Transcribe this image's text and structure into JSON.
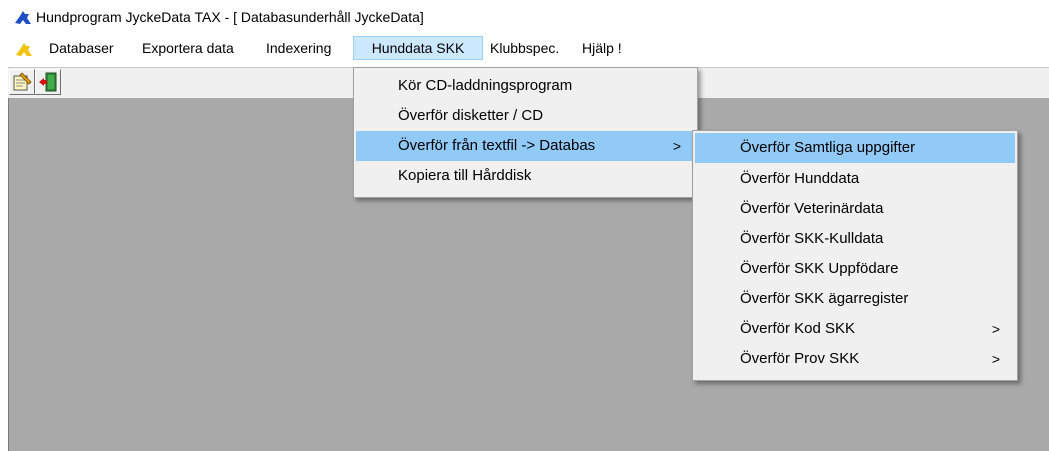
{
  "window": {
    "title": "Hundprogram JyckeData TAX - [  Databasunderhåll  JyckeData]",
    "icon": "blue-dog-icon"
  },
  "menubar": {
    "mdi_icon": "yellow-child-window-icon",
    "items": [
      {
        "label": "Databaser"
      },
      {
        "label": "Exportera data"
      },
      {
        "label": "Indexering"
      },
      {
        "label": "Hunddata SKK",
        "active": true
      },
      {
        "label": "Klubbspec."
      },
      {
        "label": "Hjälp !"
      }
    ]
  },
  "toolbar": {
    "buttons": [
      {
        "icon": "notepad-pen-icon"
      },
      {
        "icon": "exit-door-icon"
      }
    ]
  },
  "dropdown": {
    "items": [
      {
        "label": "Kör CD-laddningsprogram"
      },
      {
        "label": "Överför disketter / CD"
      },
      {
        "label": "Överför från textfil -> Databas",
        "submenu_arrow": ">",
        "highlighted": true
      },
      {
        "label": "Kopiera till Hårddisk"
      }
    ]
  },
  "submenu": {
    "items": [
      {
        "label": "Överför Samtliga uppgifter",
        "highlighted": true
      },
      {
        "label": "Överför Hunddata"
      },
      {
        "label": "Överför Veterinärdata"
      },
      {
        "label": "Överför SKK-Kulldata"
      },
      {
        "label": "Överför SKK Uppfödare"
      },
      {
        "label": "Överför SKK ägarregister"
      },
      {
        "label": "Överför Kod SKK",
        "submenu_arrow": ">"
      },
      {
        "label": "Överför Prov SKK",
        "submenu_arrow": ">"
      }
    ]
  },
  "colors": {
    "menu_background": "#f0f0f0",
    "highlight": "#91c9f7",
    "active_menu": "#cce8ff",
    "workspace": "#a9a9a9"
  }
}
